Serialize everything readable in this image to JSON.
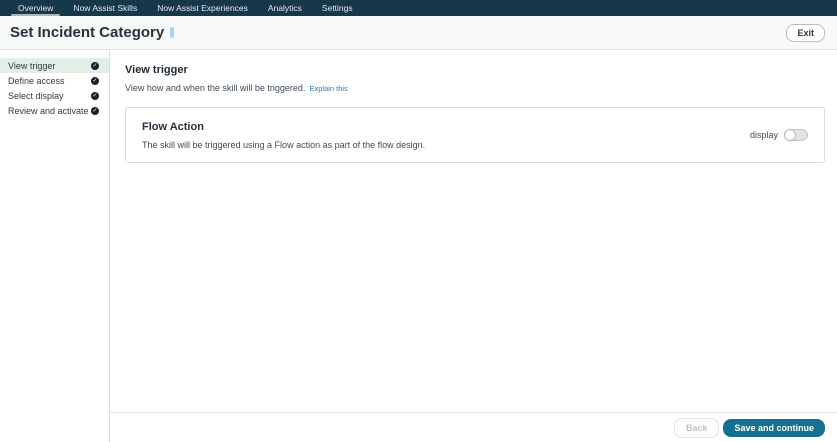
{
  "nav": {
    "items": [
      {
        "label": "Overview",
        "active": true
      },
      {
        "label": "Now Assist Skills",
        "active": false
      },
      {
        "label": "Now Assist Experiences",
        "active": false
      },
      {
        "label": "Analytics",
        "active": false
      },
      {
        "label": "Settings",
        "active": false
      }
    ]
  },
  "header": {
    "title": "Set Incident Category",
    "exit_label": "Exit",
    "info_icon": "info-icon"
  },
  "sidebar": {
    "steps": [
      {
        "label": "View trigger",
        "active": true,
        "icon": "check-circle-icon"
      },
      {
        "label": "Define access",
        "active": false,
        "icon": "check-circle-icon"
      },
      {
        "label": "Select display",
        "active": false,
        "icon": "check-circle-icon"
      },
      {
        "label": "Review and activate",
        "active": false,
        "icon": "check-circle-icon"
      }
    ]
  },
  "main": {
    "heading": "View trigger",
    "description": "View how and when the skill will be triggered.",
    "explain_link": "Explain this",
    "card": {
      "title": "Flow Action",
      "description": "The skill will be triggered using a Flow action as part of the flow design.",
      "toggle_label": "display",
      "toggle_state": "off"
    }
  },
  "footer": {
    "back_label": "Back",
    "back_enabled": false,
    "save_label": "Save and continue"
  },
  "colors": {
    "nav_bg": "#17384b",
    "primary_teal": "#15718f",
    "active_step_bg": "#e4eee5",
    "link_blue": "#2b7bb1",
    "info_icon_blue": "#a9d4ee",
    "check_circle": "#14222d"
  }
}
